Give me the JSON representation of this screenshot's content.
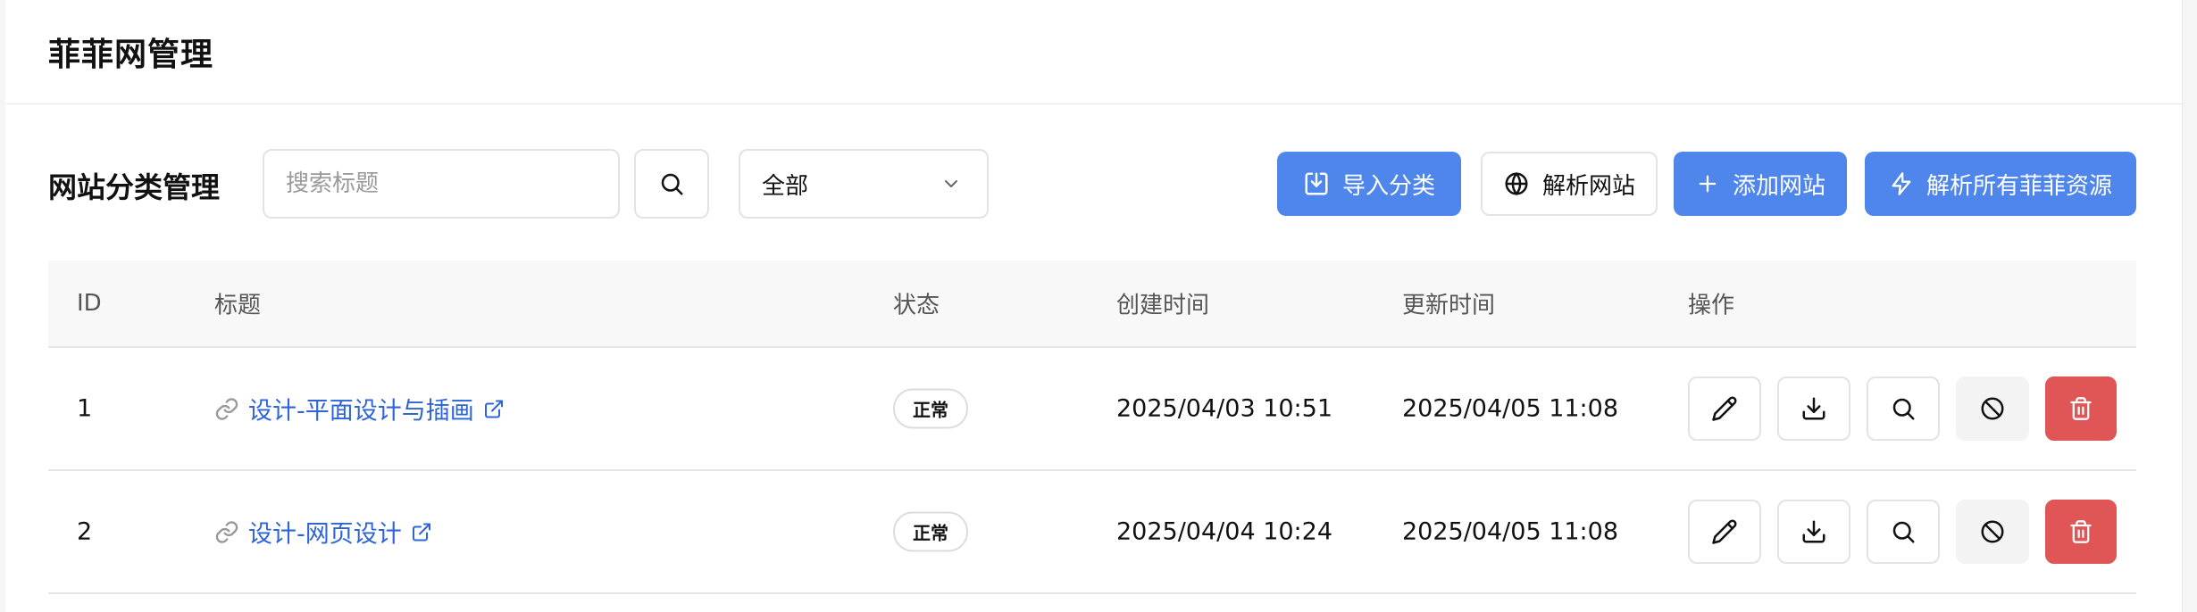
{
  "header": {
    "title": "菲菲网管理"
  },
  "toolbar": {
    "section_title": "网站分类管理",
    "search_placeholder": "搜索标题",
    "filter_value": "全部",
    "import_label": "导入分类",
    "parse_label": "解析网站",
    "add_label": "添加网站",
    "parse_all_label": "解析所有菲菲资源"
  },
  "colors": {
    "primary": "#4f86ec",
    "link": "#2e64d6",
    "danger": "#e05555"
  },
  "table": {
    "columns": [
      "ID",
      "标题",
      "状态",
      "创建时间",
      "更新时间",
      "操作"
    ],
    "rows": [
      {
        "id": "1",
        "title": "设计-平面设计与插画",
        "status": "正常",
        "created": "2025/04/03 10:51",
        "updated": "2025/04/05 11:08"
      },
      {
        "id": "2",
        "title": "设计-网页设计",
        "status": "正常",
        "created": "2025/04/04 10:24",
        "updated": "2025/04/05 11:08"
      }
    ]
  }
}
